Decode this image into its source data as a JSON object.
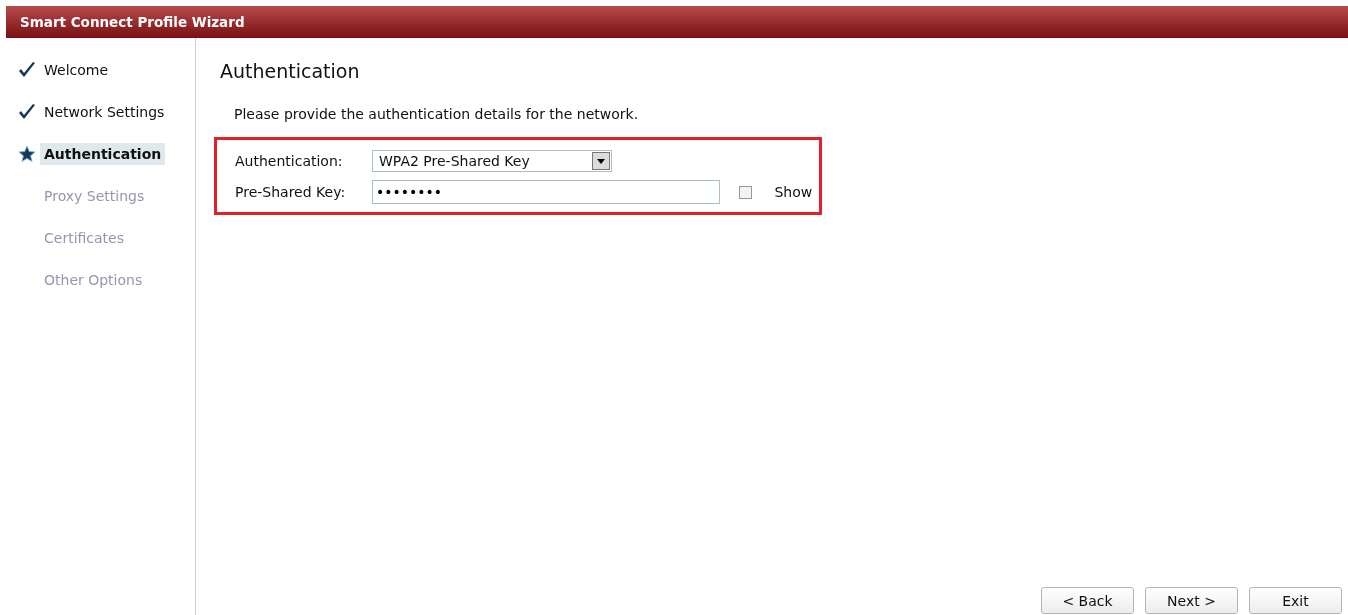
{
  "window": {
    "title": "Smart Connect Profile Wizard"
  },
  "steps": [
    {
      "label": "Welcome",
      "kind": "done"
    },
    {
      "label": "Network Settings",
      "kind": "done"
    },
    {
      "label": "Authentication",
      "kind": "current"
    },
    {
      "label": "Proxy Settings",
      "kind": "pending"
    },
    {
      "label": "Certificates",
      "kind": "pending"
    },
    {
      "label": "Other Options",
      "kind": "pending"
    }
  ],
  "heading": "Authentication",
  "description": "Please provide the authentication details for the network.",
  "form": {
    "authentication": {
      "label": "Authentication:",
      "value": "WPA2 Pre-Shared Key"
    },
    "key": {
      "label": "Pre-Shared Key:",
      "value": "••••••••"
    },
    "show": {
      "label": "Show",
      "checked": false
    }
  },
  "buttons": [
    "< Back",
    "Next >",
    "Exit"
  ]
}
